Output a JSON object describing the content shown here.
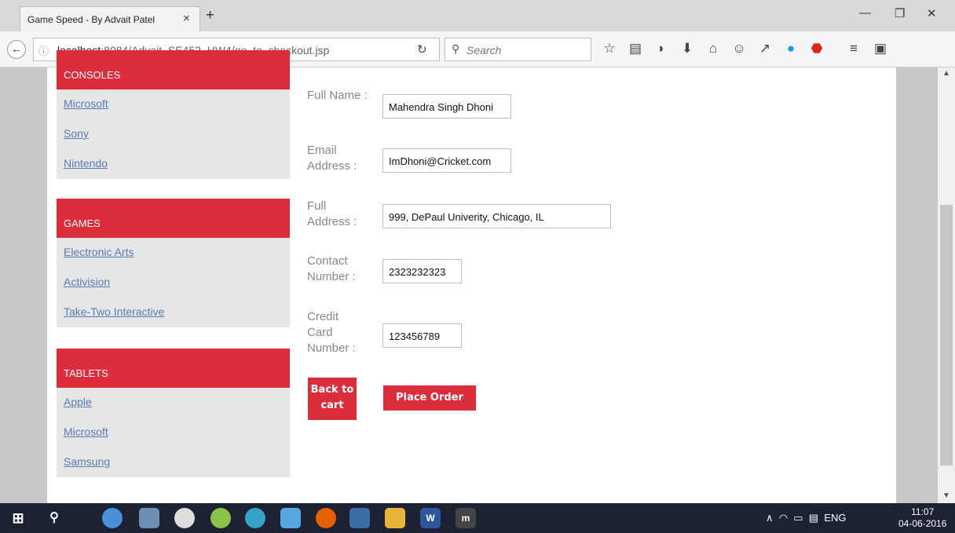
{
  "browser": {
    "tab_title": "Game Speed - By Advait Patel",
    "tab_close": "×",
    "new_tab": "+",
    "url_host": "localhost",
    "url_path": ":8084/Advait_SE452_HW4/go_to_checkout.jsp",
    "search_placeholder": "Search",
    "window": {
      "minimize": "—",
      "restore": "❐",
      "close": "✕"
    }
  },
  "sidebar": {
    "categories": [
      {
        "title": "CONSOLES",
        "items": [
          "Microsoft",
          "Sony",
          "Nintendo"
        ]
      },
      {
        "title": "GAMES",
        "items": [
          "Electronic Arts",
          "Activision",
          "Take-Two Interactive"
        ]
      },
      {
        "title": "TABLETS",
        "items": [
          "Apple",
          "Microsoft",
          "Samsung"
        ]
      }
    ]
  },
  "form": {
    "full_name": {
      "label": "Full Name :",
      "value": "Mahendra Singh Dhoni"
    },
    "email": {
      "label": "Email Address :",
      "value": "ImDhoni@Cricket.com"
    },
    "address": {
      "label": "Full Address :",
      "value": "999, DePaul Univerity, Chicago, IL"
    },
    "contact": {
      "label": "Contact Number :",
      "value": "2323232323"
    },
    "credit_card": {
      "label": "Credit Card Number :",
      "value": "123456789"
    },
    "back_button": "Back to cart",
    "place_order_button": "Place Order"
  },
  "taskbar": {
    "tray_language": "ENG",
    "time": "11:07",
    "date": "04-06-2016"
  },
  "colors": {
    "accent": "#dc2d3b",
    "sidebar_bg": "#e6e6e6",
    "link": "#5a7bb3",
    "taskbar": "#1d2233"
  }
}
